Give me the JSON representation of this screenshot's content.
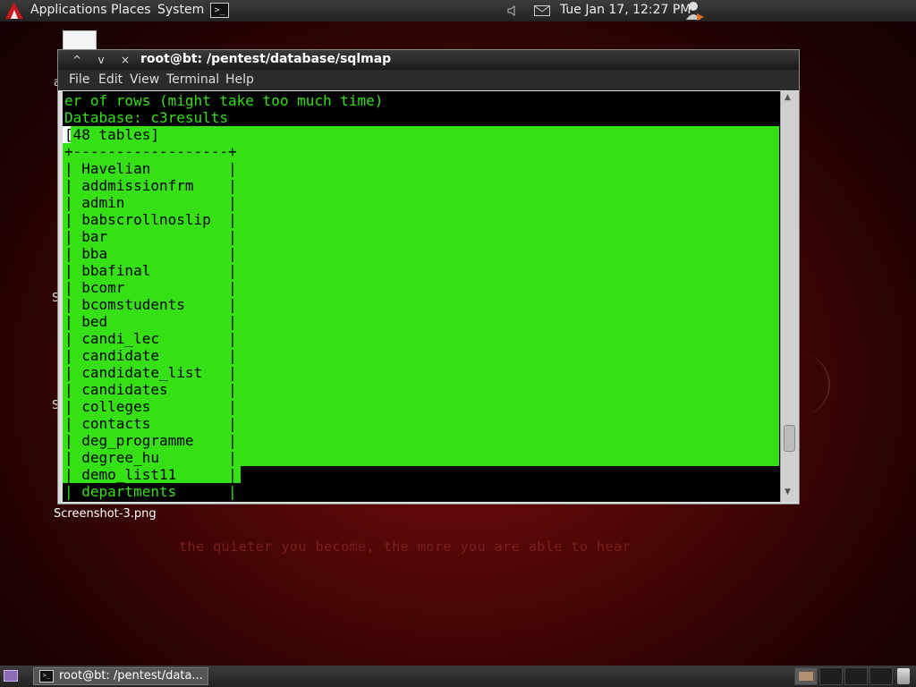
{
  "top_panel": {
    "menus": [
      "Applications",
      "Places",
      "System"
    ],
    "terminal_launcher_glyph": ">_",
    "clock": "Tue Jan 17, 12:27 PM",
    "icons": [
      "backtrack-logo-icon",
      "terminal-icon",
      "volume-icon",
      "mail-icon",
      "user-icon"
    ]
  },
  "desktop": {
    "icon_label_fragments": [
      "a",
      "S",
      "S"
    ],
    "file_label": "Screenshot-3.png",
    "wallpaper_text": "the quieter you become, the more you are able to hear"
  },
  "terminal_window": {
    "title": "root@bt: /pentest/database/sqlmap",
    "title_buttons": [
      "^",
      "v",
      "×"
    ],
    "menus": [
      "File",
      "Edit",
      "View",
      "Terminal",
      "Help"
    ],
    "lines": [
      "er of rows (might take too much time)",
      "Database: c3results",
      "[48 tables]",
      "+------------------+",
      "| Havelian         |",
      "| addmissionfrm    |",
      "| admin            |",
      "| babscrollnoslip  |",
      "| bar              |",
      "| bba              |",
      "| bbafinal         |",
      "| bcomr            |",
      "| bcomstudents     |",
      "| bed              |",
      "| candi_lec        |",
      "| candidate        |",
      "| candidate_list   |",
      "| candidates       |",
      "| colleges         |",
      "| contacts         |",
      "| deg_programme    |",
      "| degree_hu        |",
      "| demo_list11      |",
      "| departments      |"
    ],
    "colors": {
      "terminal_fg": "#35e014",
      "terminal_bg": "#000000"
    },
    "scroll_position": 0.93
  },
  "bottom_panel": {
    "task_label": "root@bt: /pentest/data...",
    "workspace_count": 4,
    "icons": [
      "show-desktop-icon",
      "terminal-icon",
      "trash-icon"
    ]
  }
}
